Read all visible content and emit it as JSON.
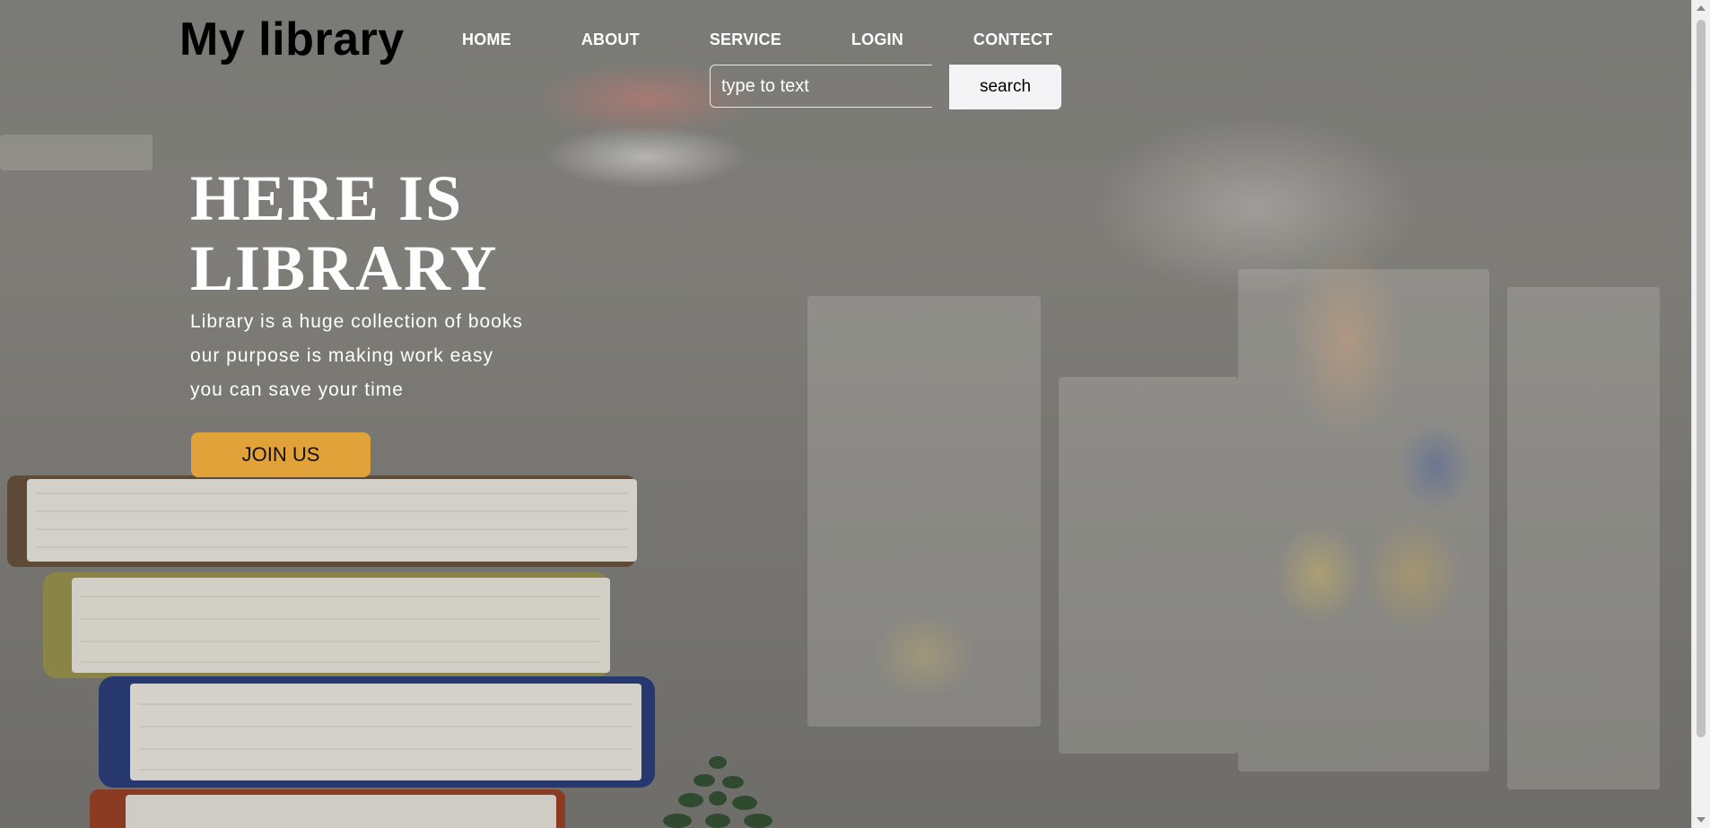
{
  "header": {
    "logo": "My library",
    "nav": [
      "HOME",
      "ABOUT",
      "SERVICE",
      "LOGIN",
      "CONTECT"
    ]
  },
  "search": {
    "placeholder": "type to text",
    "button_label": "search"
  },
  "hero": {
    "title_line1": "HERE IS",
    "title_line2": "LIBRARY",
    "lines": [
      "Library is a huge collection of books",
      "our purpose is making work easy",
      "you can save your time"
    ],
    "cta_label": "JOIN US"
  },
  "colors": {
    "accent": "#e2a23a",
    "text": "#ffffff",
    "logo": "#000000"
  }
}
